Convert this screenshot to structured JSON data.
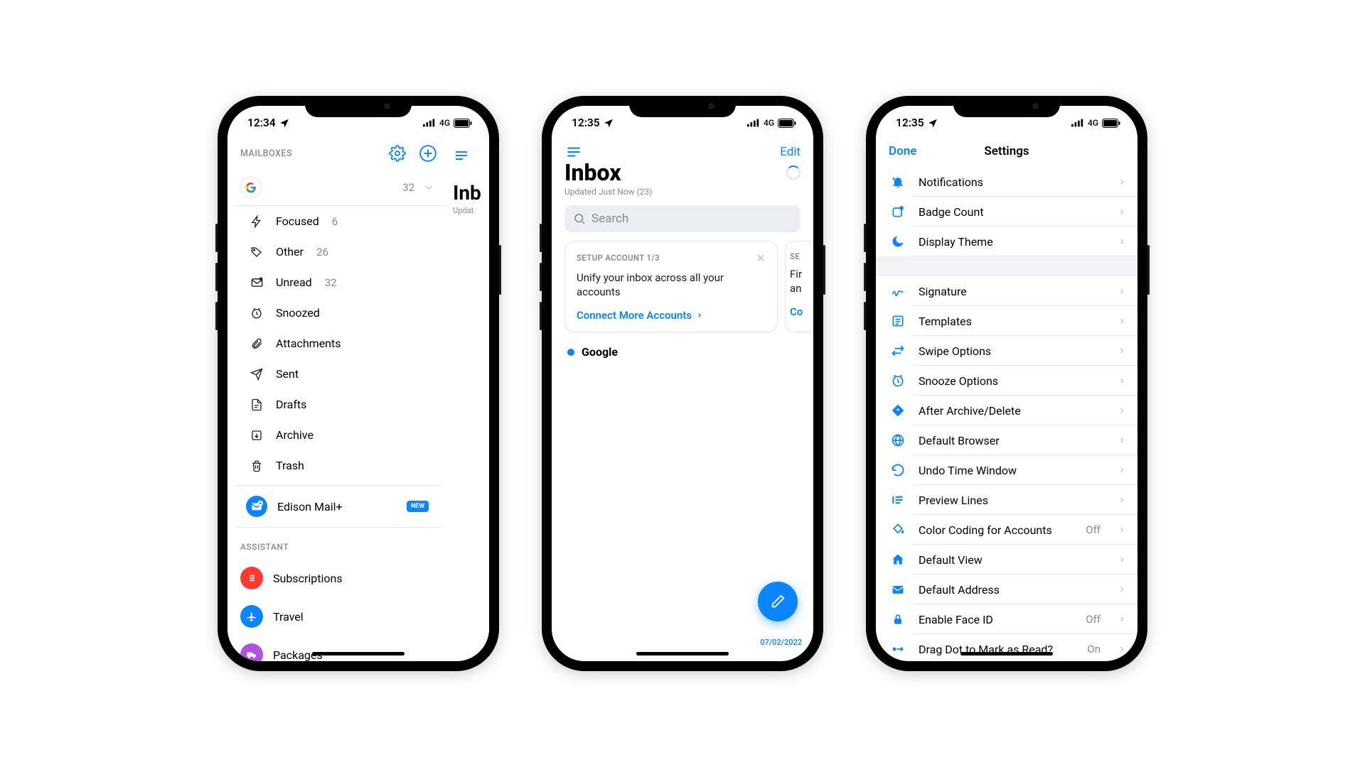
{
  "status": {
    "time1": "12:34",
    "time2": "12:35",
    "time3": "12:35",
    "net": "4G"
  },
  "p1": {
    "section": "MAILBOXES",
    "account_count": "32",
    "peek_title": "Inb",
    "peek_sub": "Updat",
    "items": [
      {
        "label": "Focused",
        "count": "6"
      },
      {
        "label": "Other",
        "count": "26"
      },
      {
        "label": "Unread",
        "count": "32"
      },
      {
        "label": "Snoozed",
        "count": ""
      },
      {
        "label": "Attachments",
        "count": ""
      },
      {
        "label": "Sent",
        "count": ""
      },
      {
        "label": "Drafts",
        "count": ""
      },
      {
        "label": "Archive",
        "count": ""
      },
      {
        "label": "Trash",
        "count": ""
      }
    ],
    "promo": {
      "label": "Edison Mail+",
      "badge": "NEW"
    },
    "assistant_section": "ASSISTANT",
    "assistant": [
      {
        "label": "Subscriptions"
      },
      {
        "label": "Travel"
      },
      {
        "label": "Packages"
      }
    ]
  },
  "p2": {
    "edit": "Edit",
    "title": "Inbox",
    "sub": "Updated Just Now (23)",
    "search_ph": "Search",
    "card1_h": "SETUP ACCOUNT 1/3",
    "card1_t": "Unify your inbox across all your accounts",
    "card1_cta": "Connect More Accounts",
    "card2_h": "SE",
    "card2_t": "Fir\nan",
    "card2_cta": "Co",
    "row_account": "Google",
    "date": "07/02/2022"
  },
  "p3": {
    "done": "Done",
    "title": "Settings",
    "group1": [
      {
        "label": "Notifications"
      },
      {
        "label": "Badge Count"
      },
      {
        "label": "Display Theme"
      }
    ],
    "group2": [
      {
        "label": "Signature",
        "val": ""
      },
      {
        "label": "Templates",
        "val": ""
      },
      {
        "label": "Swipe Options",
        "val": ""
      },
      {
        "label": "Snooze Options",
        "val": ""
      },
      {
        "label": "After Archive/Delete",
        "val": ""
      },
      {
        "label": "Default Browser",
        "val": ""
      },
      {
        "label": "Undo Time Window",
        "val": ""
      },
      {
        "label": "Preview Lines",
        "val": ""
      },
      {
        "label": "Color Coding for Accounts",
        "val": "Off"
      },
      {
        "label": "Default View",
        "val": ""
      },
      {
        "label": "Default Address",
        "val": ""
      },
      {
        "label": "Enable Face ID",
        "val": "Off"
      },
      {
        "label": "Drag Dot to Mark as Read?",
        "val": "On"
      }
    ]
  }
}
